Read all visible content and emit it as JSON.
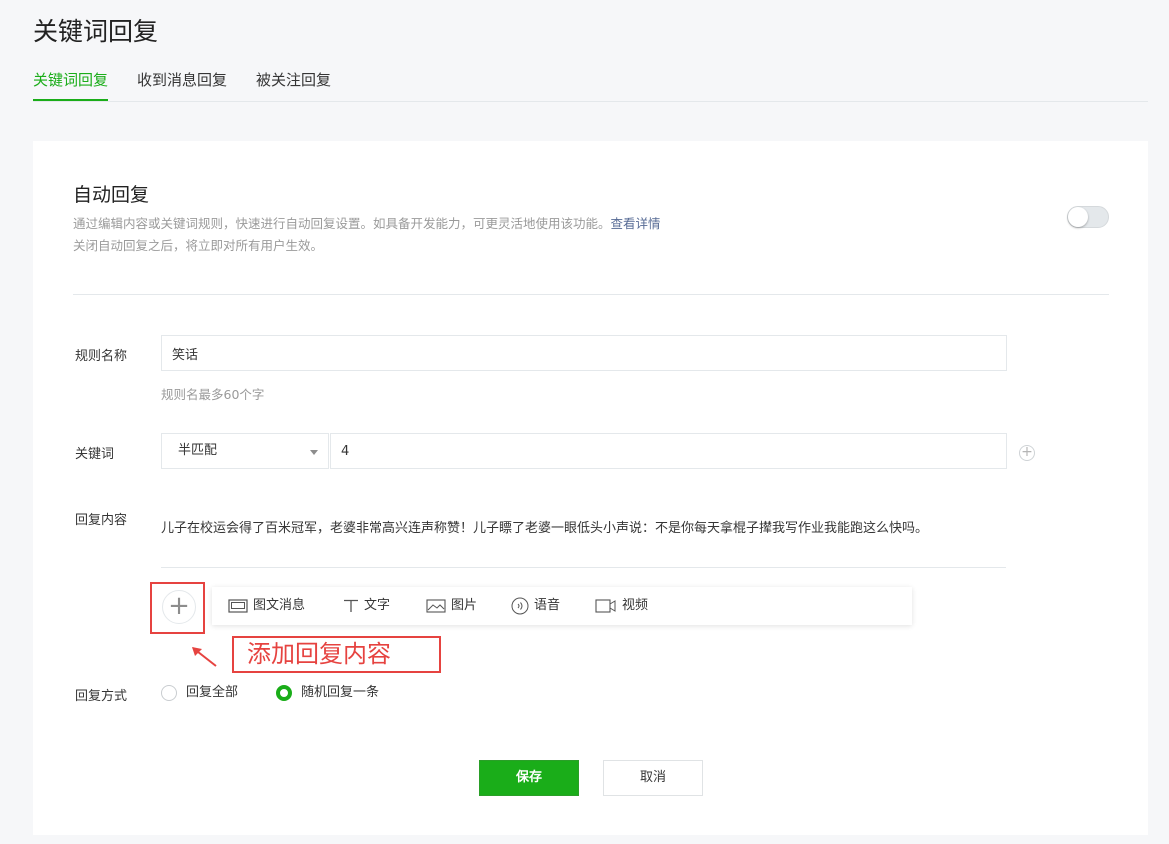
{
  "page": {
    "title": "关键词回复"
  },
  "tabs": [
    {
      "label": "关键词回复"
    },
    {
      "label": "收到消息回复"
    },
    {
      "label": "被关注回复"
    }
  ],
  "auto_reply": {
    "title": "自动回复",
    "desc_line1": "通过编辑内容或关键词规则，快速进行自动回复设置。如具备开发能力，可更灵活地使用该功能。",
    "detail_link": "查看详情",
    "desc_line2": "关闭自动回复之后，将立即对所有用户生效。",
    "toggle_on": false
  },
  "form": {
    "rule_name": {
      "label": "规则名称",
      "value": "笑话",
      "hint": "规则名最多60个字"
    },
    "keyword": {
      "label": "关键词",
      "match_mode": "半匹配",
      "value": "4"
    },
    "reply_content": {
      "label": "回复内容",
      "text": "儿子在校运会得了百米冠军，老婆非常高兴连声称赞！儿子瞟了老婆一眼低头小声说：不是你每天拿棍子撵我写作业我能跑这么快吗。"
    },
    "toolbar": [
      {
        "label": "图文消息",
        "icon": "news-icon"
      },
      {
        "label": "文字",
        "icon": "text-icon"
      },
      {
        "label": "图片",
        "icon": "image-icon"
      },
      {
        "label": "语音",
        "icon": "voice-icon"
      },
      {
        "label": "视频",
        "icon": "video-icon"
      }
    ],
    "annotation": "添加回复内容",
    "reply_mode": {
      "label": "回复方式",
      "options": [
        {
          "label": "回复全部",
          "checked": false
        },
        {
          "label": "随机回复一条",
          "checked": true
        }
      ]
    }
  },
  "actions": {
    "save": "保存",
    "cancel": "取消"
  },
  "colors": {
    "accent": "#1aad19",
    "annotation": "#e64340",
    "link": "#576b95"
  }
}
